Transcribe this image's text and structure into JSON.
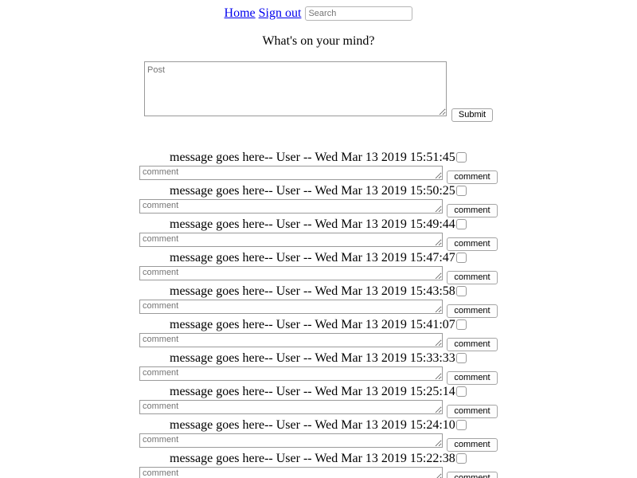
{
  "nav": {
    "home_label": "Home",
    "signout_label": "Sign out",
    "search_placeholder": "Search"
  },
  "composer": {
    "prompt": "What's on your mind?",
    "post_placeholder": "Post",
    "submit_label": "Submit"
  },
  "feed": {
    "comment_placeholder": "comment",
    "comment_button_label": "comment",
    "items": [
      {
        "message": "message goes here",
        "user": "User",
        "timestamp": "Wed Mar 13 2019 15:51:45"
      },
      {
        "message": "message goes here",
        "user": "User",
        "timestamp": "Wed Mar 13 2019 15:50:25"
      },
      {
        "message": "message goes here",
        "user": "User",
        "timestamp": "Wed Mar 13 2019 15:49:44"
      },
      {
        "message": "message goes here",
        "user": "User",
        "timestamp": "Wed Mar 13 2019 15:47:47"
      },
      {
        "message": "message goes here",
        "user": "User",
        "timestamp": "Wed Mar 13 2019 15:43:58"
      },
      {
        "message": "message goes here",
        "user": "User",
        "timestamp": "Wed Mar 13 2019 15:41:07"
      },
      {
        "message": "message goes here",
        "user": "User",
        "timestamp": "Wed Mar 13 2019 15:33:33"
      },
      {
        "message": "message goes here",
        "user": "User",
        "timestamp": "Wed Mar 13 2019 15:25:14"
      },
      {
        "message": "message goes here",
        "user": "User",
        "timestamp": "Wed Mar 13 2019 15:24:10"
      },
      {
        "message": "message goes here",
        "user": "User",
        "timestamp": "Wed Mar 13 2019 15:22:38"
      }
    ]
  }
}
